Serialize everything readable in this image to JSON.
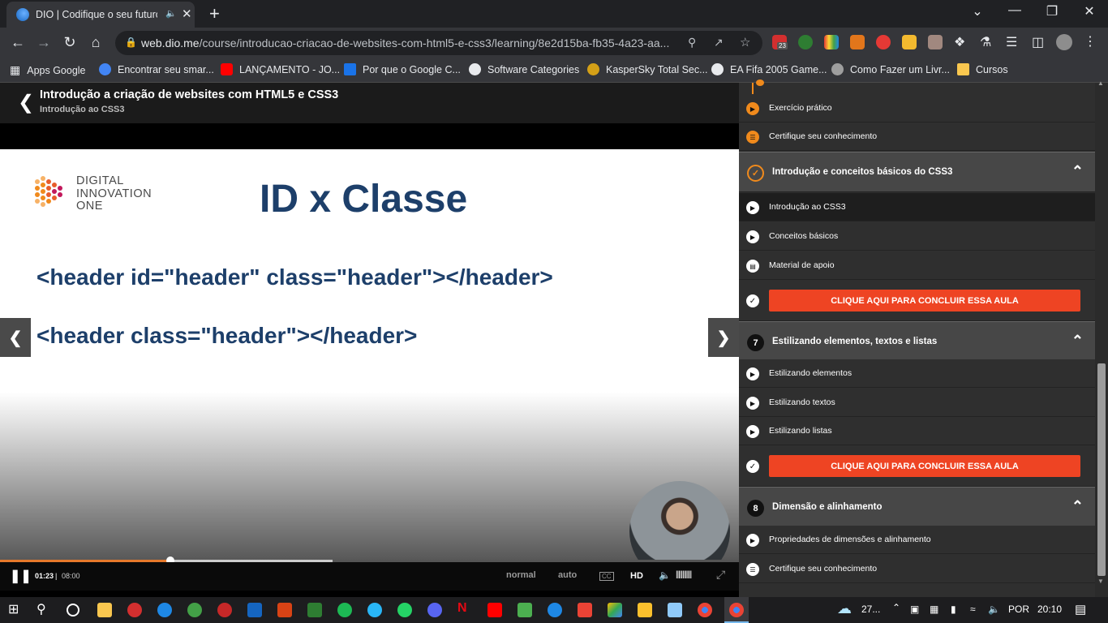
{
  "browser": {
    "tab_title": "DIO | Codifique o seu futuro",
    "new_tab": "+",
    "url_host": "web.dio.me",
    "url_path": "/course/introducao-criacao-de-websites-com-html5-e-css3/learning/8e2d15ba-fb35-4a23-aa...",
    "ext_badge": "23"
  },
  "bookmarks": [
    {
      "label": "Apps Google",
      "color": "#e8eaed"
    },
    {
      "label": "Encontrar seu smar...",
      "color": "#4285f4"
    },
    {
      "label": "LANÇAMENTO - JO...",
      "color": "#ff0000"
    },
    {
      "label": "Por que o Google C...",
      "color": "#1a73e8"
    },
    {
      "label": "Software Categories",
      "color": "#e8eaed"
    },
    {
      "label": "KasperSky Total Sec...",
      "color": "#d4a017"
    },
    {
      "label": "EA Fifa 2005 Game...",
      "color": "#e8eaed"
    },
    {
      "label": "Como Fazer um Livr...",
      "color": "#9e9e9e"
    },
    {
      "label": "Cursos",
      "color": "#f9c74f"
    }
  ],
  "course": {
    "title": "Introdução a criação de websites com HTML5 e CSS3",
    "subtitle": "Introdução ao CSS3"
  },
  "slide": {
    "logo_text": [
      "DIGITAL",
      "INNOVATION",
      "ONE"
    ],
    "title": "ID x Classe",
    "code_1": "<header id=\"header\" class=\"header\"></header>",
    "code_2": "<header class=\"header\"></header>"
  },
  "player": {
    "current_time": "01:23",
    "separator": "|",
    "duration": "08:00",
    "progress": 0.23,
    "buffered": 0.45,
    "speed": "normal",
    "quality_mode": "auto",
    "cc": "CC",
    "hd": "HD",
    "accent_color": "#e7792b"
  },
  "sidebar": {
    "top_lessons": [
      "Exercício prático",
      "Certifique seu conhecimento"
    ],
    "sections": [
      {
        "num": "",
        "title": "Introdução e conceitos básicos do CSS3",
        "lessons": [
          "Introdução ao CSS3",
          "Conceitos básicos",
          "Material de apoio"
        ],
        "button": "CLIQUE AQUI PARA CONCLUIR ESSA AULA"
      },
      {
        "num": "7",
        "title": "Estilizando elementos, textos e listas",
        "lessons": [
          "Estilizando elementos",
          "Estilizando textos",
          "Estilizando listas"
        ],
        "button": "CLIQUE AQUI PARA CONCLUIR ESSA AULA"
      },
      {
        "num": "8",
        "title": "Dimensão e alinhamento",
        "lessons": [
          "Propriedades de dimensões e alinhamento",
          "Certifique seu conhecimento"
        ]
      }
    ],
    "button_color": "#ee4423"
  },
  "taskbar": {
    "weather": "27...",
    "language": "POR",
    "time": "20:10"
  }
}
